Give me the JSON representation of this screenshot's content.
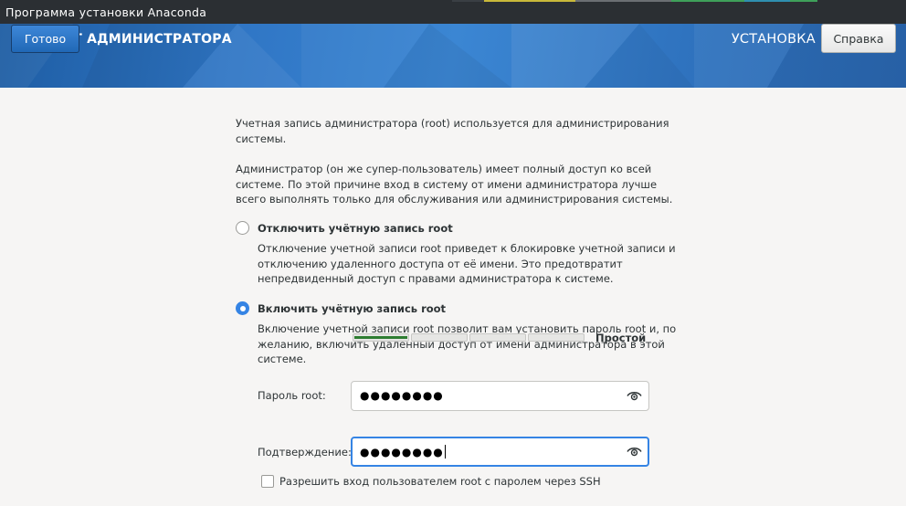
{
  "window": {
    "title": "Программа установки Anaconda"
  },
  "header": {
    "spoke_title": "АККАУНТ АДМИНИСТРАТОРА",
    "product_title": "УСТАНОВКА FEDORA 39",
    "done_label": "Готово",
    "help_label": "Справка",
    "accent_color": "#3584e4"
  },
  "intro": {
    "p1": "Учетная запись администратора (root) используется для администрирования системы.",
    "p2": "Администратор (он же супер-пользователь) имеет полный доступ ко всей системе. По этой причине вход в систему от имени администратора лучше всего выполнять только для обслуживания или администрирования системы."
  },
  "options": {
    "disable": {
      "label": "Отключить учётную запись root",
      "description": "Отключение учетной записи root приведет к блокировке учетной записи и отключению удаленного доступа от её имени. Это предотвратит непредвиденный доступ с правами администратора к системе.",
      "selected": false
    },
    "enable": {
      "label": "Включить учётную запись root",
      "description": "Включение учетной записи root позволит вам установить пароль root и, по желанию, включить удаленный доступ от имени администратора в этой системе.",
      "selected": true
    }
  },
  "password": {
    "label": "Пароль root:",
    "value": "●●●●●●●●",
    "icon": "eye-icon"
  },
  "strength": {
    "level_fraction": 0.25,
    "text": "Простой",
    "color": "#2e7d32"
  },
  "confirm": {
    "label": "Подтверждение:",
    "value": "●●●●●●●●",
    "icon": "eye-icon"
  },
  "ssh": {
    "label": "Разрешить вход пользователем root с паролем через SSH",
    "checked": false
  }
}
